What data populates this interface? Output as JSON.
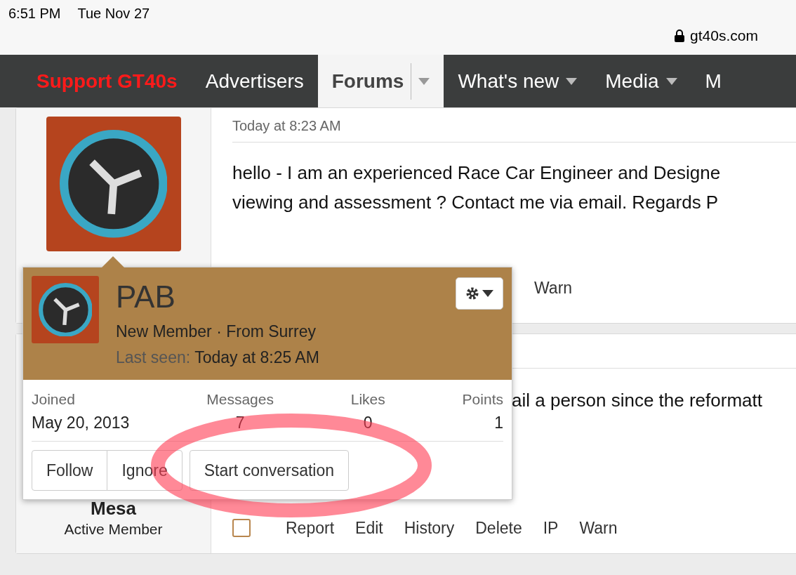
{
  "status_bar": {
    "time": "6:51 PM",
    "date": "Tue Nov 27",
    "url": "gt40s.com"
  },
  "nav": [
    {
      "label": "Support GT40s",
      "kind": "promo",
      "selected": false,
      "has_menu": false
    },
    {
      "label": "Advertisers",
      "kind": "link",
      "selected": false,
      "has_menu": false
    },
    {
      "label": "Forums",
      "kind": "link",
      "selected": true,
      "has_menu": true
    },
    {
      "label": "What's new",
      "kind": "link",
      "selected": false,
      "has_menu": true
    },
    {
      "label": "Media",
      "kind": "link",
      "selected": false,
      "has_menu": true
    },
    {
      "label": "M",
      "kind": "link",
      "selected": false,
      "has_menu": false
    }
  ],
  "posts": [
    {
      "date": "Today at 8:23 AM",
      "lines": [
        "hello - I am an experienced Race Car Engineer and Designe",
        "viewing and assessment ? Contact me via email. Regards P"
      ],
      "has_photo": true,
      "covered": false,
      "actions": [
        "Warn"
      ]
    },
    {
      "author": "Mesa",
      "role": "Active Member",
      "lines": [
        "ail a person since the reformatt"
      ],
      "has_photo": false,
      "covered": true,
      "checked": false,
      "actions": [
        "Report",
        "Edit",
        "History",
        "Delete",
        "IP",
        "Warn"
      ]
    }
  ],
  "popup": {
    "name": "PAB",
    "subtitle": "New Member · From Surrey",
    "last_seen_label": "Last seen:",
    "last_seen": "Today at 8:25 AM",
    "stats": [
      {
        "label": "Joined",
        "value": "May 20, 2013"
      },
      {
        "label": "Messages",
        "value": "7"
      },
      {
        "label": "Likes",
        "value": "0"
      },
      {
        "label": "Points",
        "value": "1"
      }
    ],
    "buttons": [
      "Follow",
      "Ignore",
      "Start conversation"
    ]
  },
  "annotation": {
    "kind": "ellipse"
  }
}
